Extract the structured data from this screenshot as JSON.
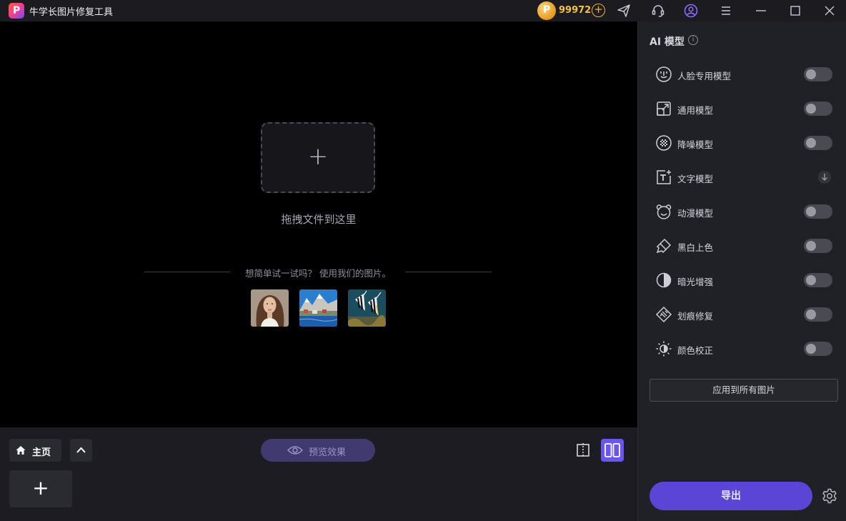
{
  "app": {
    "logo_letter": "P",
    "title": "牛学长图片修复工具",
    "coins": {
      "count": "99972",
      "coin_letter": "P",
      "add_symbol": "+"
    }
  },
  "canvas": {
    "drop_plus": "+",
    "drop_text": "拖拽文件到这里",
    "try_text": "想简单试一试吗？ 使用我们的图片。",
    "samples": [
      "woman-portrait",
      "lakeside-mountain-village",
      "tropical-fish"
    ]
  },
  "bottombar": {
    "home_label": "主页",
    "add_plus": "+",
    "preview_label": "预览效果"
  },
  "panel": {
    "title": "AI 模型",
    "info_symbol": "i",
    "models": [
      {
        "label": "人脸专用模型",
        "icon": "face-icon",
        "control": "toggle",
        "on": false
      },
      {
        "label": "通用模型",
        "icon": "expand-icon",
        "control": "toggle",
        "on": false
      },
      {
        "label": "降噪模型",
        "icon": "noise-icon",
        "control": "toggle",
        "on": false
      },
      {
        "label": "文字模型",
        "icon": "text-icon",
        "control": "download",
        "on": false
      },
      {
        "label": "动漫模型",
        "icon": "bear-icon",
        "control": "toggle",
        "on": false
      },
      {
        "label": "黑白上色",
        "icon": "brush-icon",
        "control": "toggle",
        "on": false
      },
      {
        "label": "暗光增强",
        "icon": "contrast-icon",
        "control": "toggle",
        "on": false
      },
      {
        "label": "划痕修复",
        "icon": "scratch-icon",
        "control": "toggle",
        "on": false
      },
      {
        "label": "颜色校正",
        "icon": "sun-icon",
        "control": "toggle",
        "on": false
      }
    ],
    "apply_label": "应用到所有图片",
    "export_label": "导出"
  },
  "colors": {
    "accent": "#6a55f0",
    "export": "#5b45d6",
    "coin": "#f2c14f"
  }
}
